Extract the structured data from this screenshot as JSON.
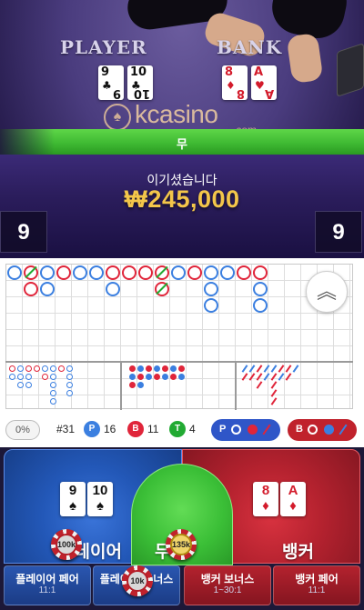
{
  "video": {
    "player_label": "PLAYER",
    "banker_label": "BANK",
    "player_cards": [
      {
        "rank": "9",
        "suit": "♣",
        "color": "#111111"
      },
      {
        "rank": "10",
        "suit": "♣",
        "color": "#111111"
      }
    ],
    "banker_cards": [
      {
        "rank": "8",
        "suit": "♦",
        "color": "#d31b2b"
      },
      {
        "rank": "A",
        "suit": "♥",
        "color": "#d31b2b"
      }
    ],
    "logo_text": "kcasino",
    "logo_sub": ".com",
    "logo_badge": "♠"
  },
  "result": {
    "label": "무",
    "win_title": "이기셨습니다",
    "win_amount": "₩245,000",
    "player_score": "9",
    "banker_score": "9"
  },
  "roadmap": {
    "collapse_icon": "︽"
  },
  "stats": {
    "percent": "0%",
    "shoe": "#31",
    "player_badge": "P",
    "player_count": "16",
    "banker_badge": "B",
    "banker_count": "11",
    "tie_badge": "T",
    "tie_count": "4",
    "player_ask": "P",
    "banker_ask": "B",
    "colors": {
      "player": "#3b7fe0",
      "banker": "#e0253a",
      "tie": "#22aa33"
    }
  },
  "betting": {
    "player_label": "플레이어",
    "banker_label": "뱅커",
    "tie_label": "무",
    "player_cards": [
      {
        "rank": "9",
        "suit": "♠",
        "color": "#111111"
      },
      {
        "rank": "10",
        "suit": "♠",
        "color": "#111111"
      }
    ],
    "banker_cards": [
      {
        "rank": "8",
        "suit": "♦",
        "color": "#d31b2b"
      },
      {
        "rank": "A",
        "suit": "♦",
        "color": "#d31b2b"
      }
    ],
    "player_chip": "100k",
    "tie_chip": "135k",
    "side_chip": "10k",
    "side_bets": [
      {
        "title": "플레이어 페어",
        "payout": "11:1"
      },
      {
        "title": "플레이어 보너스",
        "payout": ""
      },
      {
        "title": "뱅커 보너스",
        "payout": "1~30:1"
      },
      {
        "title": "뱅커 페어",
        "payout": "11:1"
      }
    ]
  }
}
